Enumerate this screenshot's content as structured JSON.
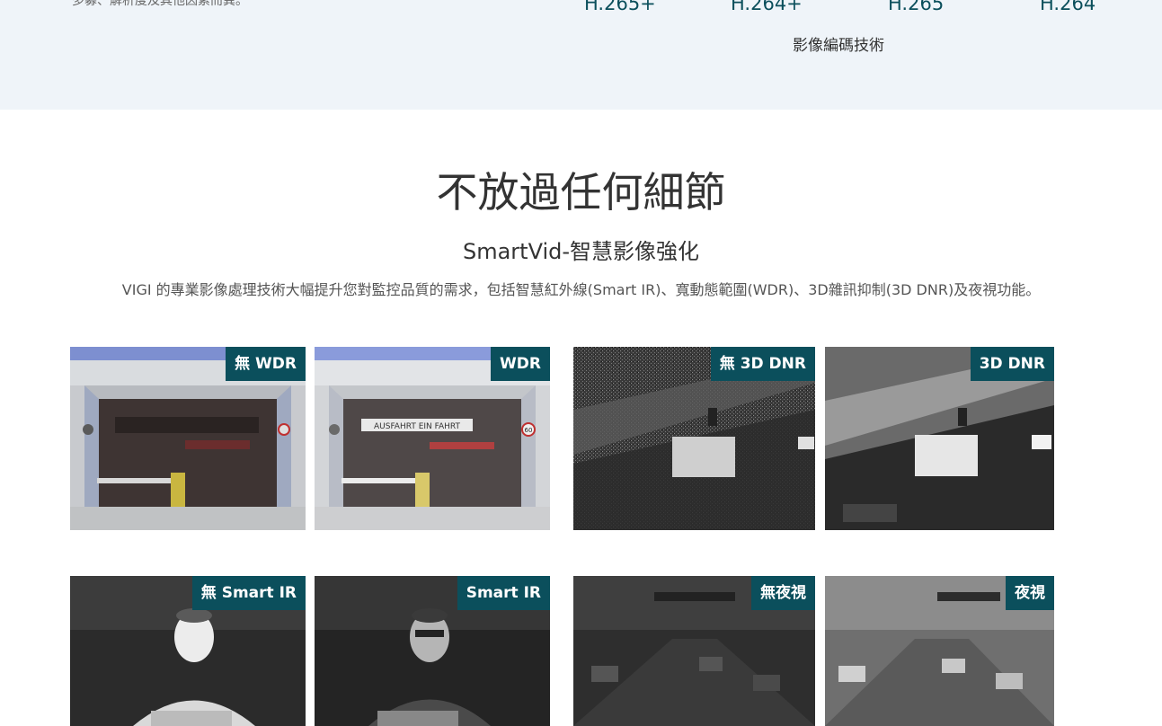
{
  "codec_section": {
    "description": "多募、解析度及其他因素而異。",
    "values": [
      "H.265+",
      "H.264+",
      "H.265",
      "H.264"
    ],
    "caption": "影像編碼技術"
  },
  "details_section": {
    "title": "不放過任何細節",
    "subtitle": "SmartVid-智慧影像強化",
    "description": "VIGI 的專業影像處理技術大幅提升您對監控品質的需求，包括智慧紅外線(Smart IR)、寬動態範圍(WDR)、3D雜訊抑制(3D DNR)及夜視功能。"
  },
  "comparisons": {
    "wdr_off": "無 WDR",
    "wdr_on": "WDR",
    "dnr_off": "無 3D DNR",
    "dnr_on": "3D DNR",
    "ir_off": "無 Smart IR",
    "ir_on": "Smart IR",
    "night_off": "無夜視",
    "night_on": "夜視"
  },
  "scene_text": {
    "garage_sign": "AUSFAHRT EIN FAHRT",
    "speed_sign": "60"
  },
  "colors": {
    "badge": "#0b4f5c",
    "band": "#eff4f9"
  }
}
